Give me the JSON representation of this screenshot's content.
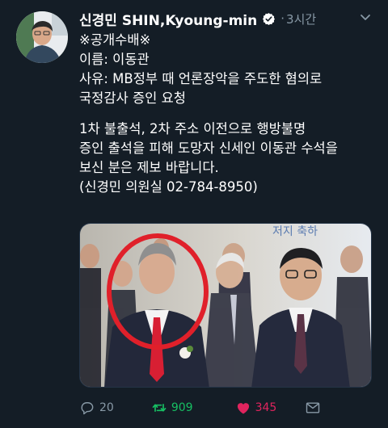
{
  "tweet": {
    "author_name": "신경민 SHIN,Kyoung-min",
    "separator": "·",
    "time": "3시간",
    "lines": [
      "※공개수배※",
      "이름: 이동관",
      "사유: MB정부 때 언론장악을 주도한 혐의로",
      "국정감사 증인 요청",
      "",
      "1차 불출석, 2차 주소 이전으로 행방불명",
      "증인 출석을 피해 도망자 신세인 이동관 수석을",
      "보신 분은 제보 바랍니다.",
      "(신경민 의원실 02-784-8950)"
    ],
    "media_background_text": "저지 축하",
    "stats": {
      "replies": "20",
      "retweets": "909",
      "likes": "345"
    }
  },
  "colors": {
    "background": "#141d26",
    "text": "#ffffff",
    "muted": "#8899a6",
    "retweet": "#17bf63",
    "like": "#e0245e",
    "verified": "#ffffff",
    "highlight_circle": "#e0202a"
  },
  "icons": {
    "verified": "verified-badge-icon",
    "menu": "chevron-down-icon",
    "reply": "reply-icon",
    "retweet": "retweet-icon",
    "like": "heart-icon",
    "message": "direct-message-icon"
  }
}
